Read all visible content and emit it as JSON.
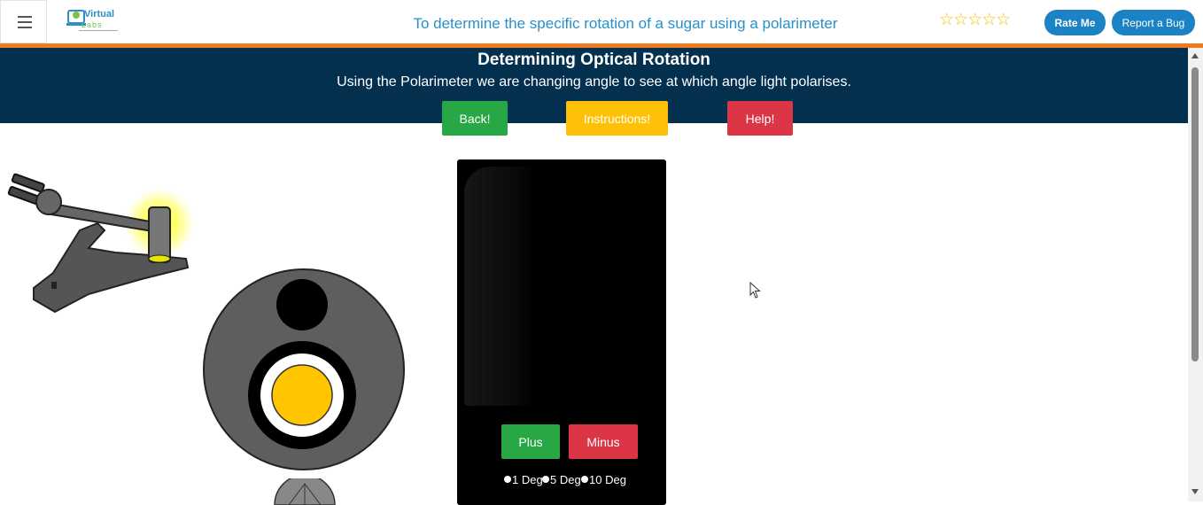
{
  "navbar": {
    "logo_text": "Virtual",
    "logo_subtext": "Labs",
    "title": "To determine the specific rotation of a sugar using a polarimeter",
    "rating_stars": "☆☆☆☆☆",
    "rate_label": "Rate Me",
    "bug_label": "Report a Bug"
  },
  "header": {
    "title": "Determining Optical Rotation",
    "subtitle": "Using the Polarimeter we are changing angle to see at which angle light polarises.",
    "back_label": "Back!",
    "instructions_label": "Instructions!",
    "help_label": "Help!"
  },
  "controls": {
    "plus_label": "Plus",
    "minus_label": "Minus",
    "step_options": [
      "1 Deg",
      "5 Deg",
      "10 Deg"
    ]
  },
  "colors": {
    "header_band": "#04304f",
    "accent_orange": "#f07b1f",
    "green": "#28a745",
    "yellow": "#ffc107",
    "red": "#dc3545",
    "brand_blue": "#1b82c5"
  }
}
